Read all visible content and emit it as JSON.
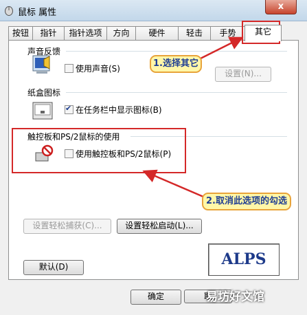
{
  "window": {
    "title": "鼠标 属性",
    "close_glyph": "x"
  },
  "tabs": [
    {
      "label": "按钮"
    },
    {
      "label": "指针"
    },
    {
      "label": "指针选项"
    },
    {
      "label": "方向"
    },
    {
      "label": "硬件"
    },
    {
      "label": "轻击"
    },
    {
      "label": "手势"
    },
    {
      "label": "其它",
      "active": true
    }
  ],
  "sound": {
    "title": "声音反馈",
    "checkbox_label": "使用声音(S)",
    "checked": false,
    "settings_button": "设置(N)..."
  },
  "tray": {
    "title": "纸盒图标",
    "checkbox_label": "在任务栏中显示图标(B)",
    "checked": true
  },
  "touchpad": {
    "title": "触控板和PS/2鼠标的使用",
    "checkbox_label": "使用触控板和PS/2鼠标(P)",
    "checked": false
  },
  "buttons": {
    "easy_capture": "设置轻松捕获(C)...",
    "easy_launch": "设置轻松启动(L)...",
    "default": "默认(D)",
    "ok": "确定",
    "cancel_partial": "取"
  },
  "logo": {
    "text": "ALPS"
  },
  "annotations": {
    "callout1": "1.选择其它",
    "callout2": "2.取消此选项的勾选"
  },
  "watermark": {
    "text": "易坊好文馆"
  },
  "colors": {
    "annotation_red": "#d42828",
    "callout_fill": "#fff7a8",
    "callout_text": "#1f3f94",
    "logo_blue": "#1d3a8a"
  }
}
